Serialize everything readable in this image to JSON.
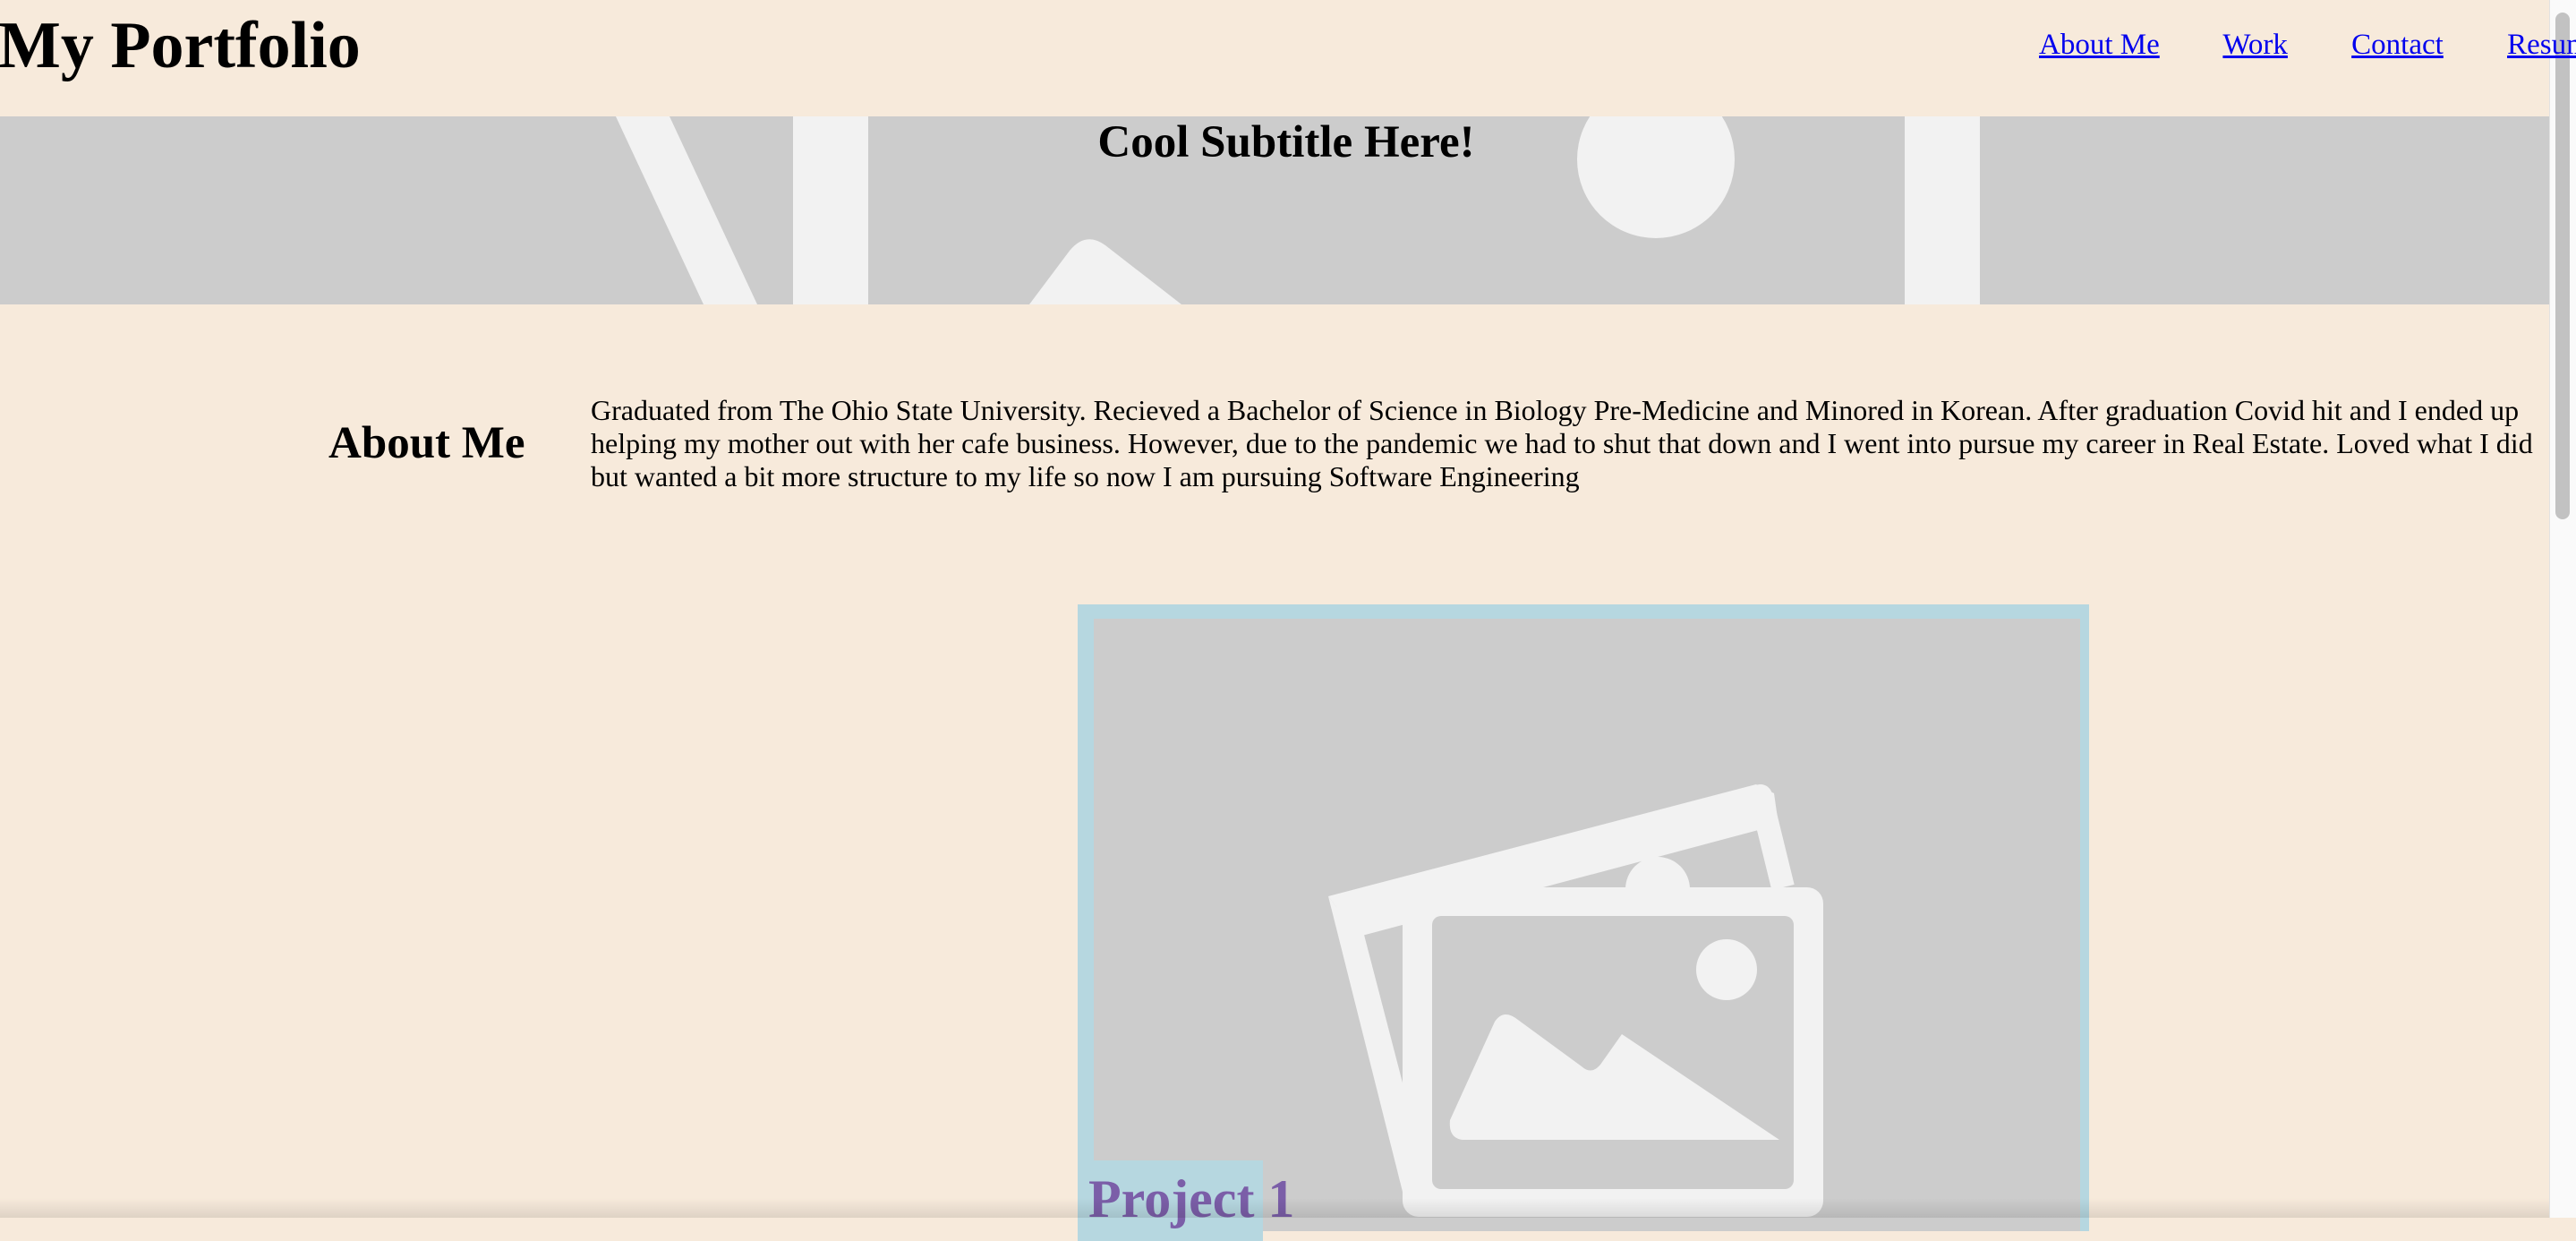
{
  "header": {
    "site_title": "My Portfolio",
    "nav": [
      {
        "label": "About Me"
      },
      {
        "label": "Work"
      },
      {
        "label": "Contact"
      },
      {
        "label": "Resum"
      }
    ]
  },
  "hero": {
    "subtitle": "Cool Subtitle Here!",
    "background_icon": "image-placeholder-icon"
  },
  "about": {
    "heading": "About Me",
    "text": "Graduated from The Ohio State University. Recieved a Bachelor of Science in Biology Pre-Medicine and Minored in Korean. After graduation Covid hit and I ended up helping my mother out with her cafe business. However, due to the pandemic we had to shut that down and I went into pursue my career in Real Estate. Loved what I did but wanted a bit more structure to my life so now I am pursuing Software Engineering"
  },
  "work": {
    "card_image_icon": "image-placeholder-icon",
    "card_label": "Project 1"
  },
  "colors": {
    "page_background": "#f7eadb",
    "card_background": "#b6d7e0",
    "placeholder_gray": "#cccccc",
    "link": "#0000ee",
    "card_label": "#7b5ea8"
  }
}
